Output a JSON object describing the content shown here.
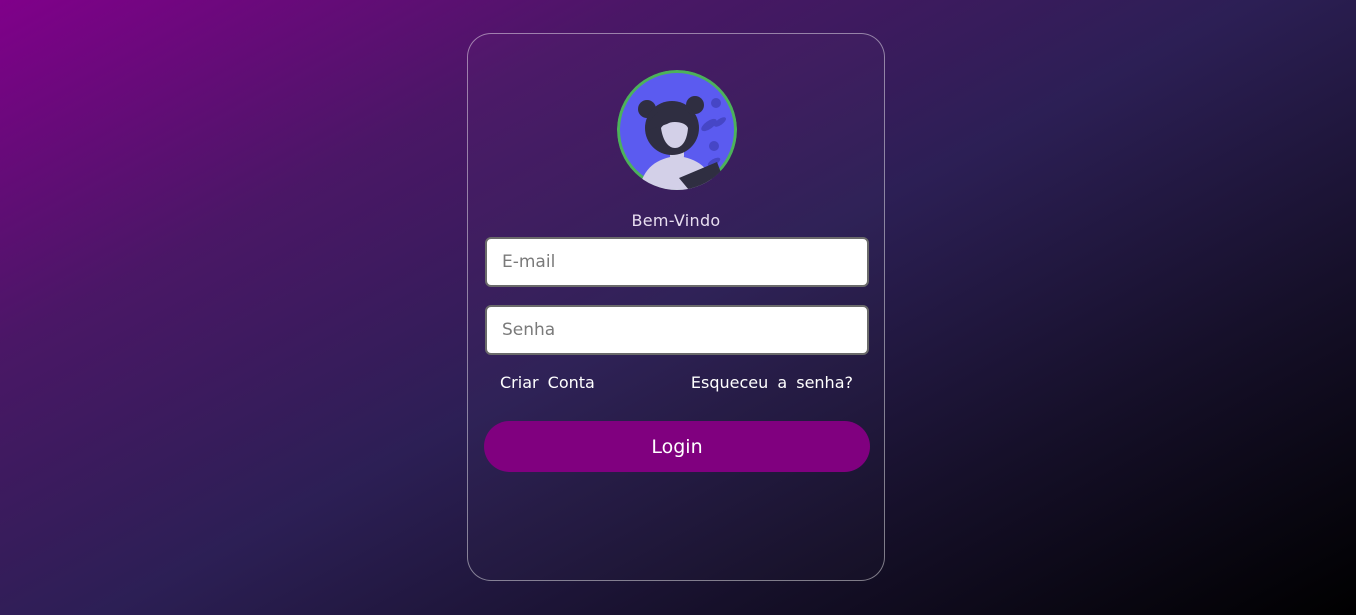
{
  "welcome_text": "Bem-Vindo",
  "email": {
    "placeholder": "E-mail",
    "value": ""
  },
  "senha": {
    "placeholder": "Senha",
    "value": ""
  },
  "links": {
    "criar_conta": "Criar Conta",
    "esqueceu_senha": "Esqueceu a senha?"
  },
  "login_button": "Login",
  "avatar_icon": "user-avatar-illustration",
  "colors": {
    "accent": "#80007f",
    "avatar_bg": "#5b5bf0",
    "avatar_ring": "#4cb25a"
  }
}
